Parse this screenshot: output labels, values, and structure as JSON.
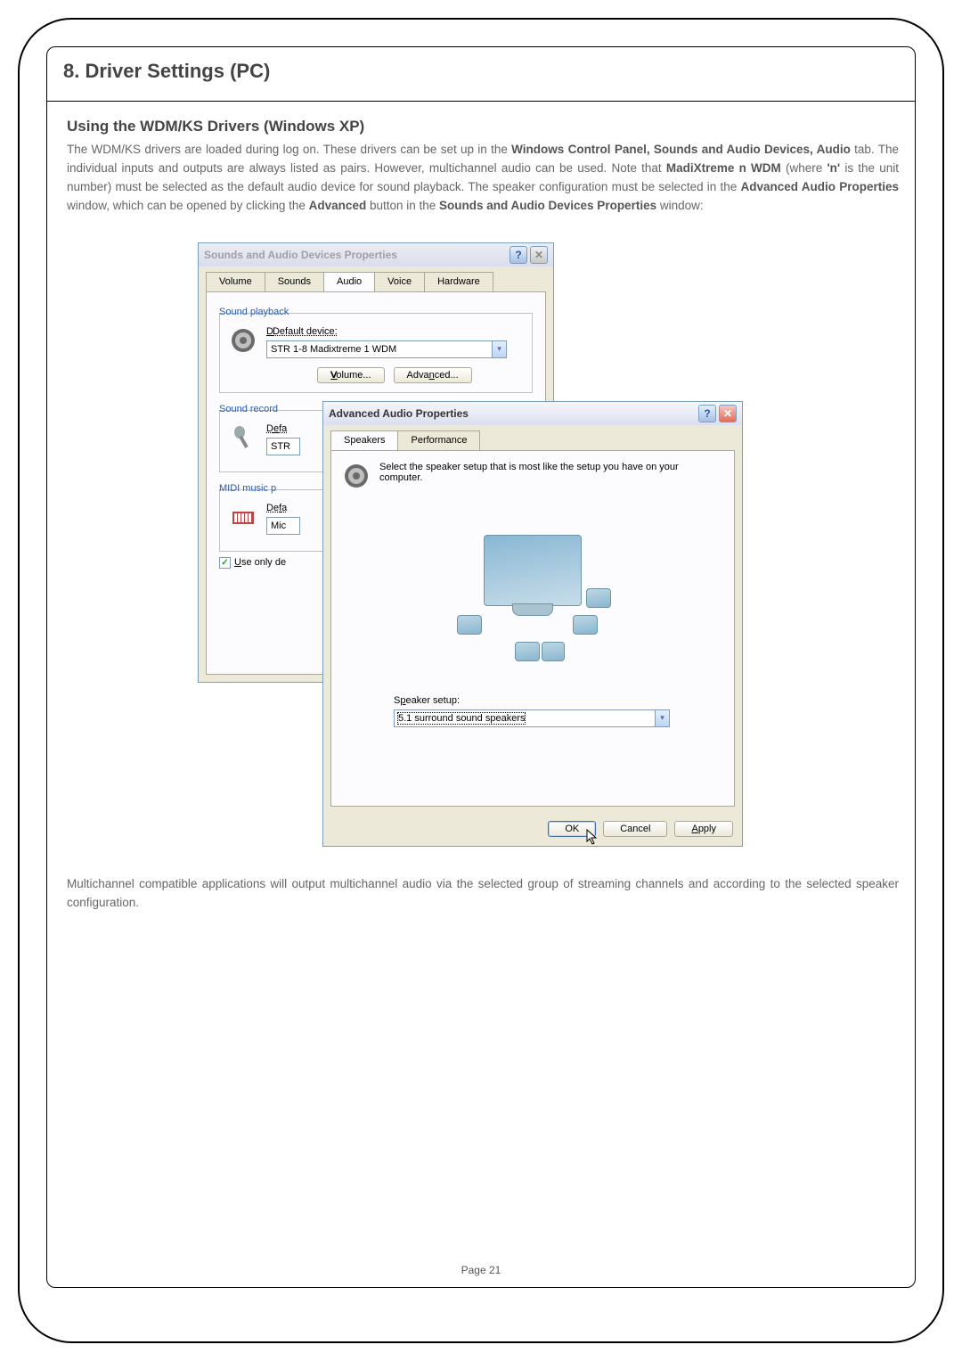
{
  "document": {
    "section_heading": "8. Driver Settings (PC)",
    "sub_heading": "Using the WDM/KS Drivers (Windows XP)",
    "para1_pre": "The WDM/KS drivers are loaded during log on. These drivers can be set up in the ",
    "para1_b1": "Windows Control Panel, Sounds and Audio Devices, Audio",
    "para1_mid1": " tab. The individual inputs and outputs are always listed as pairs. However, multichannel audio can be used. Note that ",
    "para1_b2": "MadiXtreme n WDM",
    "para1_mid2": " (where ",
    "para1_b3": "'n'",
    "para1_mid3": " is the unit number) must be selected as the default audio device for sound playback. The speaker configuration must be selected in the ",
    "para1_b4": "Advanced Audio Properties",
    "para1_mid4": " window, which can be opened by clicking the ",
    "para1_b5": "Advanced",
    "para1_mid5": " button in the ",
    "para1_b6": "Sounds and Audio Devices Properties",
    "para1_end": " window:",
    "para2": "Multichannel compatible applications will output multichannel audio via the selected group of streaming channels and according to the selected speaker configuration.",
    "page_label": "Page",
    "page_num": "21"
  },
  "dlg1": {
    "title": "Sounds and Audio Devices Properties",
    "tabs": {
      "volume": "Volume",
      "sounds": "Sounds",
      "audio": "Audio",
      "voice": "Voice",
      "hardware": "Hardware"
    },
    "playback_group": "Sound playback",
    "default_device": "Default device:",
    "playback_selected": "STR 1-8 Madixtreme 1 WDM",
    "volume_btn": "Volume...",
    "advanced_btn": "Advanced...",
    "record_group": "Sound record",
    "record_default_lbl": "Defa",
    "record_selected": "STR",
    "midi_group": "MIDI music p",
    "midi_default_lbl": "Defa",
    "midi_selected": "Mic",
    "use_only": "Use only de"
  },
  "dlg2": {
    "title": "Advanced Audio Properties",
    "tabs": {
      "speakers": "Speakers",
      "performance": "Performance"
    },
    "hint": "Select the speaker setup that is most like the setup you have on your computer.",
    "spk_label": "Speaker setup:",
    "spk_selected": "5.1 surround sound speakers",
    "ok": "OK",
    "cancel": "Cancel",
    "apply": "Apply"
  }
}
